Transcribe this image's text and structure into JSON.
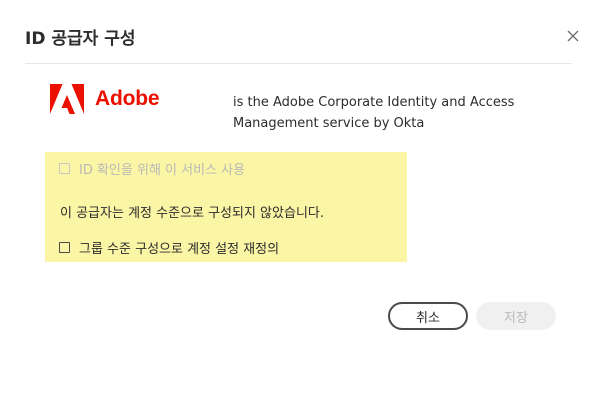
{
  "dialog": {
    "title": "ID 공급자 구성",
    "close_icon": "close-icon"
  },
  "logo": {
    "text": "Adobe",
    "icon": "adobe-logo-icon",
    "color": "#eb1000"
  },
  "description": {
    "line1": "is the Adobe Corporate Identity and Access",
    "line2": "Management service by Okta"
  },
  "options": {
    "use_service_label": "ID 확인을 위해 이 서비스 사용",
    "use_service_checked": false,
    "use_service_disabled": true,
    "notice": "이 공급자는 계정 수준으로 구성되지 않았습니다.",
    "override_label": "그룹 수준 구성으로 계정 설정 재정의",
    "override_checked": false
  },
  "buttons": {
    "cancel": "취소",
    "save": "저장"
  },
  "colors": {
    "highlight": "#fbf5a6",
    "disabled_text": "#b9b9b9"
  }
}
